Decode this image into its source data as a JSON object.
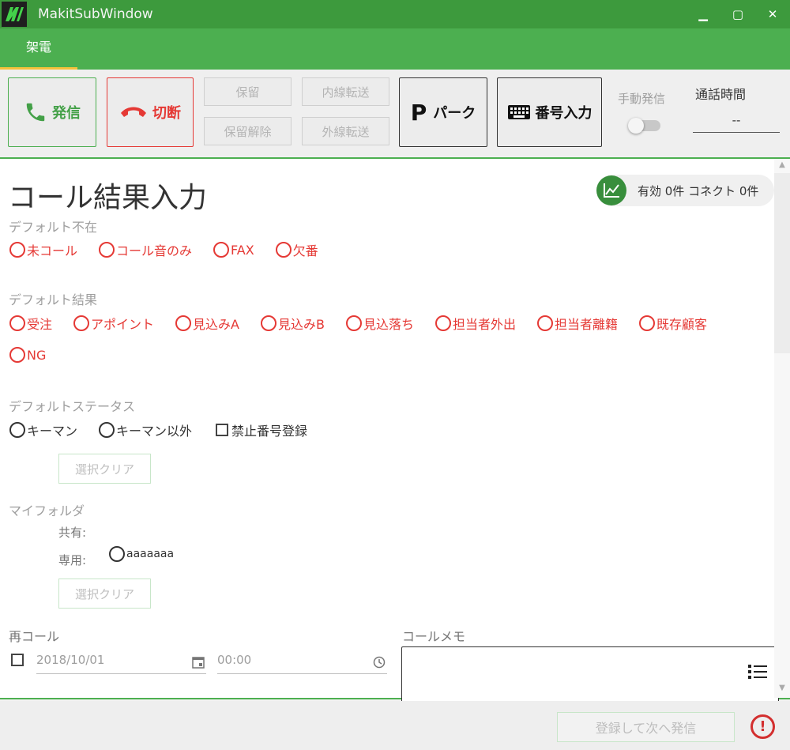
{
  "window": {
    "title": "MakitSubWindow",
    "minimize": "▁",
    "maximize": "▢",
    "close": "✕"
  },
  "tabs": [
    {
      "label": "架電",
      "active": true
    }
  ],
  "toolbar": {
    "dial": "発信",
    "hangup": "切断",
    "hold": "保留",
    "unhold": "保留解除",
    "internal_transfer": "内線転送",
    "external_transfer": "外線転送",
    "park": "パーク",
    "park_icon": "P",
    "keypad": "番号入力",
    "manual_dial": "手動発信",
    "talk_time_label": "通話時間",
    "talk_time_value": "--"
  },
  "content": {
    "heading": "コール結果入力",
    "stats": "有効 0件 コネクト 0件",
    "default_absent": {
      "label": "デフォルト不在",
      "options": [
        "未コール",
        "コール音のみ",
        "FAX",
        "欠番"
      ]
    },
    "default_result": {
      "label": "デフォルト結果",
      "options": [
        "受注",
        "アポイント",
        "見込みA",
        "見込みB",
        "見込落ち",
        "担当者外出",
        "担当者離籍",
        "既存顧客",
        "NG"
      ]
    },
    "default_status": {
      "label": "デフォルトステータス",
      "options": [
        "キーマン",
        "キーマン以外"
      ],
      "checkbox": "禁止番号登録",
      "clear": "選択クリア"
    },
    "my_folder": {
      "label": "マイフォルダ",
      "shared_label": "共有:",
      "private_label": "専用:",
      "private_option": "aaaaaaa",
      "clear": "選択クリア"
    },
    "recall": {
      "label": "再コール",
      "date": "2018/10/01",
      "time": "00:00"
    },
    "memo": {
      "label": "コールメモ"
    }
  },
  "footer": {
    "submit": "登録して次へ発信",
    "alert": "!"
  },
  "colors": {
    "green": "#4caf50",
    "dark_green": "#3d9a3d",
    "red": "#e53935",
    "tab_underline": "#f5c23b"
  }
}
